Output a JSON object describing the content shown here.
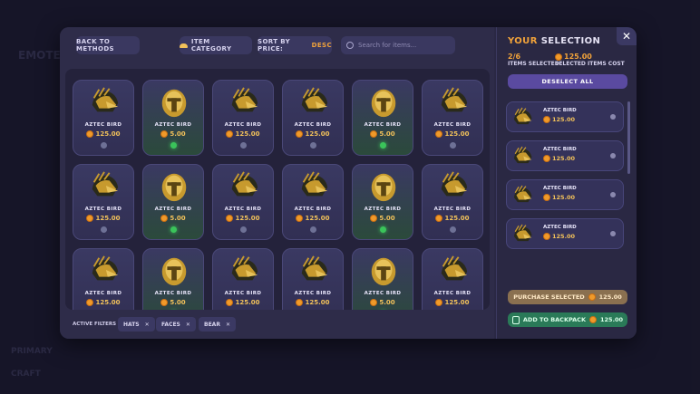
{
  "background": {
    "texts": [
      "EMOTE",
      "PRIMARY",
      "CRAFT"
    ]
  },
  "toolbar": {
    "back_label": "BACK TO METHODS",
    "category_label": "ITEM CATEGORY",
    "sort_label": "SORT BY PRICE:",
    "sort_value": "DESC",
    "search_placeholder": "Search for items..."
  },
  "items": [
    {
      "name": "AZTEC BIRD",
      "price": "125.00",
      "helmet": "bird",
      "status": "gray"
    },
    {
      "name": "AZTEC BIRD",
      "price": "5.00",
      "helmet": "gold",
      "status": "green"
    },
    {
      "name": "AZTEC BIRD",
      "price": "125.00",
      "helmet": "bird",
      "status": "gray"
    },
    {
      "name": "AZTEC BIRD",
      "price": "125.00",
      "helmet": "bird",
      "status": "gray"
    },
    {
      "name": "AZTEC BIRD",
      "price": "5.00",
      "helmet": "gold",
      "status": "green"
    },
    {
      "name": "AZTEC BIRD",
      "price": "125.00",
      "helmet": "bird",
      "status": "gray"
    },
    {
      "name": "AZTEC BIRD",
      "price": "125.00",
      "helmet": "bird",
      "status": "gray"
    },
    {
      "name": "AZTEC BIRD",
      "price": "5.00",
      "helmet": "gold",
      "status": "green"
    },
    {
      "name": "AZTEC BIRD",
      "price": "125.00",
      "helmet": "bird",
      "status": "gray"
    },
    {
      "name": "AZTEC BIRD",
      "price": "125.00",
      "helmet": "bird",
      "status": "gray"
    },
    {
      "name": "AZTEC BIRD",
      "price": "5.00",
      "helmet": "gold",
      "status": "green"
    },
    {
      "name": "AZTEC BIRD",
      "price": "125.00",
      "helmet": "bird",
      "status": "gray"
    },
    {
      "name": "AZTEC BIRD",
      "price": "125.00",
      "helmet": "bird",
      "status": "gray"
    },
    {
      "name": "AZTEC BIRD",
      "price": "5.00",
      "helmet": "gold",
      "status": "green"
    },
    {
      "name": "AZTEC BIRD",
      "price": "125.00",
      "helmet": "bird",
      "status": "gray"
    },
    {
      "name": "AZTEC BIRD",
      "price": "125.00",
      "helmet": "bird",
      "status": "gray"
    },
    {
      "name": "AZTEC BIRD",
      "price": "5.00",
      "helmet": "gold",
      "status": "green"
    },
    {
      "name": "AZTEC BIRD",
      "price": "125.00",
      "helmet": "bird",
      "status": "gray"
    }
  ],
  "filters": {
    "label": "ACTIVE FILTERS",
    "chips": [
      "HATS",
      "FACES",
      "BEAR"
    ]
  },
  "selection": {
    "title_a": "YOUR",
    "title_b": "SELECTION",
    "count": "2/6",
    "count_label": "ITEMS SELECTED",
    "cost": "125.00",
    "cost_label": "SELECTED ITEMS COST",
    "deselect_label": "DESELECT ALL",
    "list": [
      {
        "name": "AZTEC BIRD",
        "price": "125.00"
      },
      {
        "name": "AZTEC BIRD",
        "price": "125.00"
      },
      {
        "name": "AZTEC BIRD",
        "price": "125.00"
      },
      {
        "name": "AZTEC BIRD",
        "price": "125.00"
      }
    ],
    "purchase_label": "PURCHASE SELECTED",
    "purchase_price": "125.00",
    "backpack_label": "ADD TO BACKPACK",
    "backpack_price": "125.00"
  },
  "colors": {
    "accent": "#f2a33a",
    "panel": "#2e2c49",
    "green": "#3ac45a"
  }
}
